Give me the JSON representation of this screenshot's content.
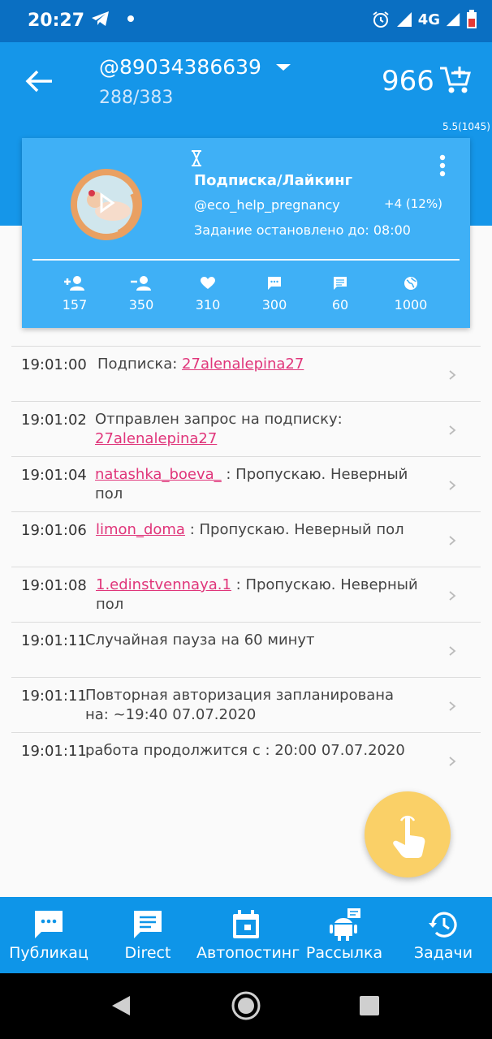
{
  "status_bar": {
    "time": "20:27",
    "network": "4G"
  },
  "header": {
    "account": "@89034386639",
    "counter": "288/383",
    "balance": "966",
    "version": "5.5(1045)"
  },
  "task_card": {
    "name": "Подписка/Лайкинг",
    "username": "@eco_help_pregnancy",
    "delta": "+4 (12%)",
    "status": "Задание остановлено до: 08:00",
    "stats": [
      {
        "icon": "add-follow-icon",
        "value": "157"
      },
      {
        "icon": "unfollow-icon",
        "value": "350"
      },
      {
        "icon": "heart-icon",
        "value": "310"
      },
      {
        "icon": "comment-icon",
        "value": "300"
      },
      {
        "icon": "message-icon",
        "value": "60"
      },
      {
        "icon": "globe-icon",
        "value": "1000"
      }
    ]
  },
  "log": [
    {
      "time": "19:01:00",
      "prefix": "Подписка: ",
      "link": "27alenalepina27",
      "suffix": ""
    },
    {
      "time": "19:01:02",
      "prefix": "Отправлен запрос на подписку: ",
      "link": "27alenalepina27",
      "suffix": ""
    },
    {
      "time": "19:01:04",
      "prefix": "",
      "link": "natashka_boeva_",
      "suffix": " : Пропускаю. Неверный пол"
    },
    {
      "time": "19:01:06",
      "prefix": "",
      "link": "limon_doma",
      "suffix": " : Пропускаю. Неверный пол"
    },
    {
      "time": "19:01:08",
      "prefix": "",
      "link": "1.edinstvennaya.1",
      "suffix": " : Пропускаю. Неверный пол"
    },
    {
      "time": "19:01:11",
      "prefix": "Случайная пауза на 60 минут",
      "link": "",
      "suffix": ""
    },
    {
      "time": "19:01:11",
      "prefix": "Повторная авторизация запланирована на: ~19:40 07.07.2020",
      "link": "",
      "suffix": ""
    },
    {
      "time": "19:01:11",
      "prefix": "работа продолжится с : 20:00 07.07.2020",
      "link": "",
      "suffix": ""
    }
  ],
  "bottom_nav": [
    {
      "icon": "publication-icon",
      "label": "Публикац"
    },
    {
      "icon": "direct-icon",
      "label": "Direct"
    },
    {
      "icon": "calendar-icon",
      "label": "Автопостинг"
    },
    {
      "icon": "android-message-icon",
      "label": "Рассылка"
    },
    {
      "icon": "history-icon",
      "label": "Задачи"
    }
  ],
  "colors": {
    "primary": "#1596e9",
    "status_bar": "#0a6fc2",
    "card": "#3fb0f6",
    "link": "#e0357a",
    "fab": "#fad067"
  }
}
